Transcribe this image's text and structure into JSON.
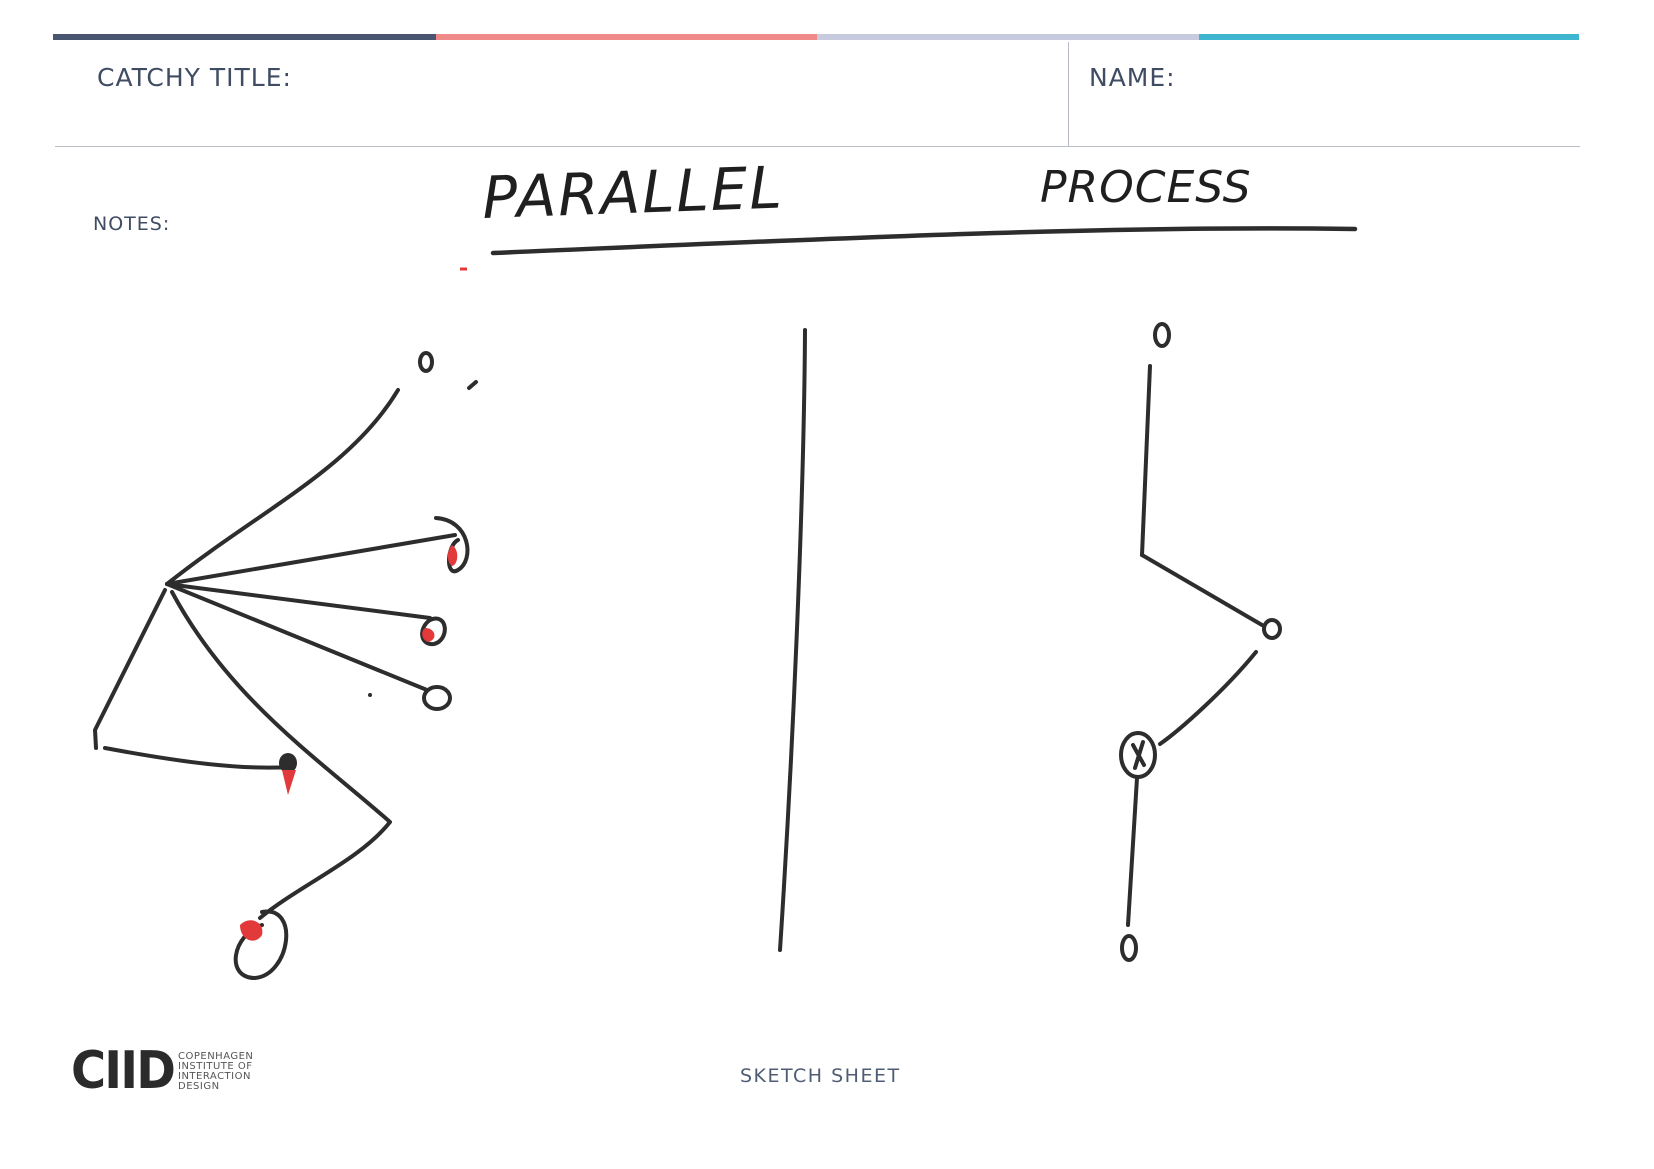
{
  "header": {
    "catchy_title_label": "CATCHY TITLE:",
    "name_label": "NAME:",
    "accent_colors": [
      "#4a5570",
      "#f08a88",
      "#c8cbe0",
      "#3fb6d0"
    ]
  },
  "notes": {
    "label": "NOTES:",
    "handwritten_title_left": "PARALLEL",
    "handwritten_title_right": "PROCESS"
  },
  "sketch": {
    "ink_color": "#2d2d2d",
    "highlight_color": "#e23a3a"
  },
  "footer": {
    "logo": "CIID",
    "logo_lines": [
      "COPENHAGEN",
      "INSTITUTE OF",
      "INTERACTION",
      "DESIGN"
    ],
    "sheet_label": "SKETCH SHEET"
  }
}
